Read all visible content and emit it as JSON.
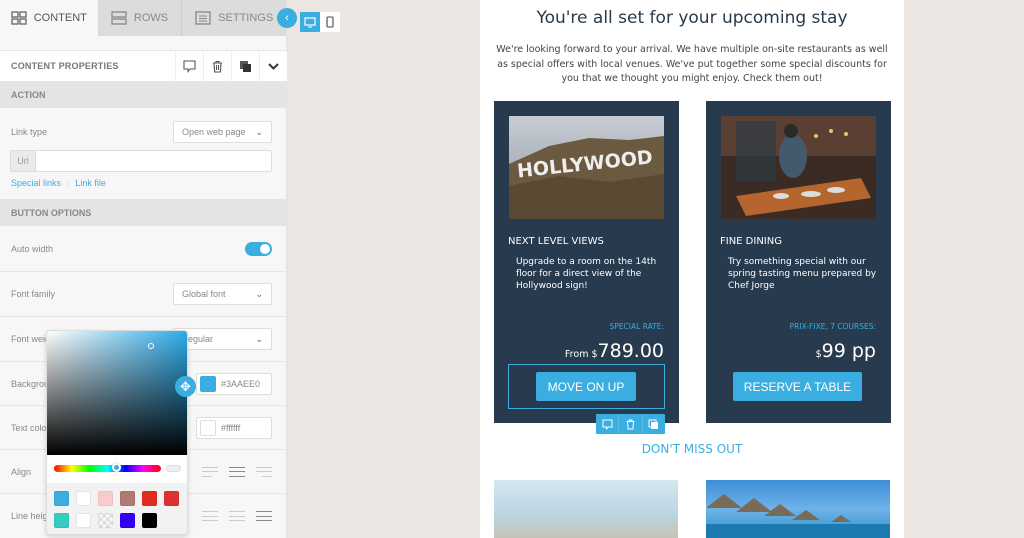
{
  "sidebar": {
    "tabs": [
      {
        "label": "CONTENT",
        "icon": "grid-icon",
        "active": true
      },
      {
        "label": "ROWS",
        "icon": "rows-icon",
        "active": false
      },
      {
        "label": "SETTINGS",
        "icon": "settings-icon",
        "active": false
      }
    ],
    "content_properties": {
      "title": "CONTENT PROPERTIES",
      "actions": [
        "comment-icon",
        "trash-icon",
        "duplicate-icon",
        "chevron-down-icon"
      ]
    },
    "action_section": {
      "title": "ACTION",
      "link_type_label": "Link type",
      "link_type_value": "Open web page",
      "url_prefix": "Url",
      "url_value": "",
      "special_links": "Special links",
      "link_file": "Link file"
    },
    "button_options": {
      "title": "BUTTON OPTIONS",
      "auto_width_label": "Auto width",
      "auto_width_on": true,
      "font_family_label": "Font family",
      "font_family_value": "Global font",
      "font_weight_label": "Font weig",
      "font_weight_value": "egular",
      "background_label": "Backgrou",
      "background_value": "#3AAEE0",
      "text_color_label": "Text color",
      "text_color_value": "#ffffff",
      "align_label": "Align",
      "line_height_label": "Line heig"
    },
    "color_picker": {
      "presets": [
        "#3aaee0",
        "#ffffff",
        "#f9cccc",
        "#b07a72",
        "#e12c1f",
        "#de3232",
        "#37cbc4",
        "#ffffff",
        "checker",
        "#3200f5",
        "#000000"
      ]
    }
  },
  "toolbar": {
    "collapse_icon": "chevron-left-icon",
    "devices": [
      "desktop-icon",
      "mobile-icon"
    ]
  },
  "email": {
    "headline": "You're all set for your upcoming stay",
    "intro": "We're looking forward to your arrival. We have multiple on-site restaurants as well as special offers with local venues. We've put together some special discounts for you that we thought you might enjoy. Check them out!",
    "cards": [
      {
        "title": "NEXT LEVEL VIEWS",
        "desc": "Upgrade to a room on the 14th floor for a direct view of the Hollywood sign!",
        "rate_label": "SPECIAL RATE:",
        "price_prefix": "From $",
        "price": "789.00",
        "cta": "MOVE ON UP",
        "image_text": "HOLLYWOOD"
      },
      {
        "title": "FINE DINING",
        "desc": "Try something special with our spring tasting menu prepared by Chef Jorge",
        "rate_label": "PRIX-FIXE, 7 COURSES:",
        "price_prefix": "$",
        "price": "99 pp",
        "cta": "RESERVE A TABLE"
      }
    ],
    "section_title": "DON'T MISS OUT"
  }
}
